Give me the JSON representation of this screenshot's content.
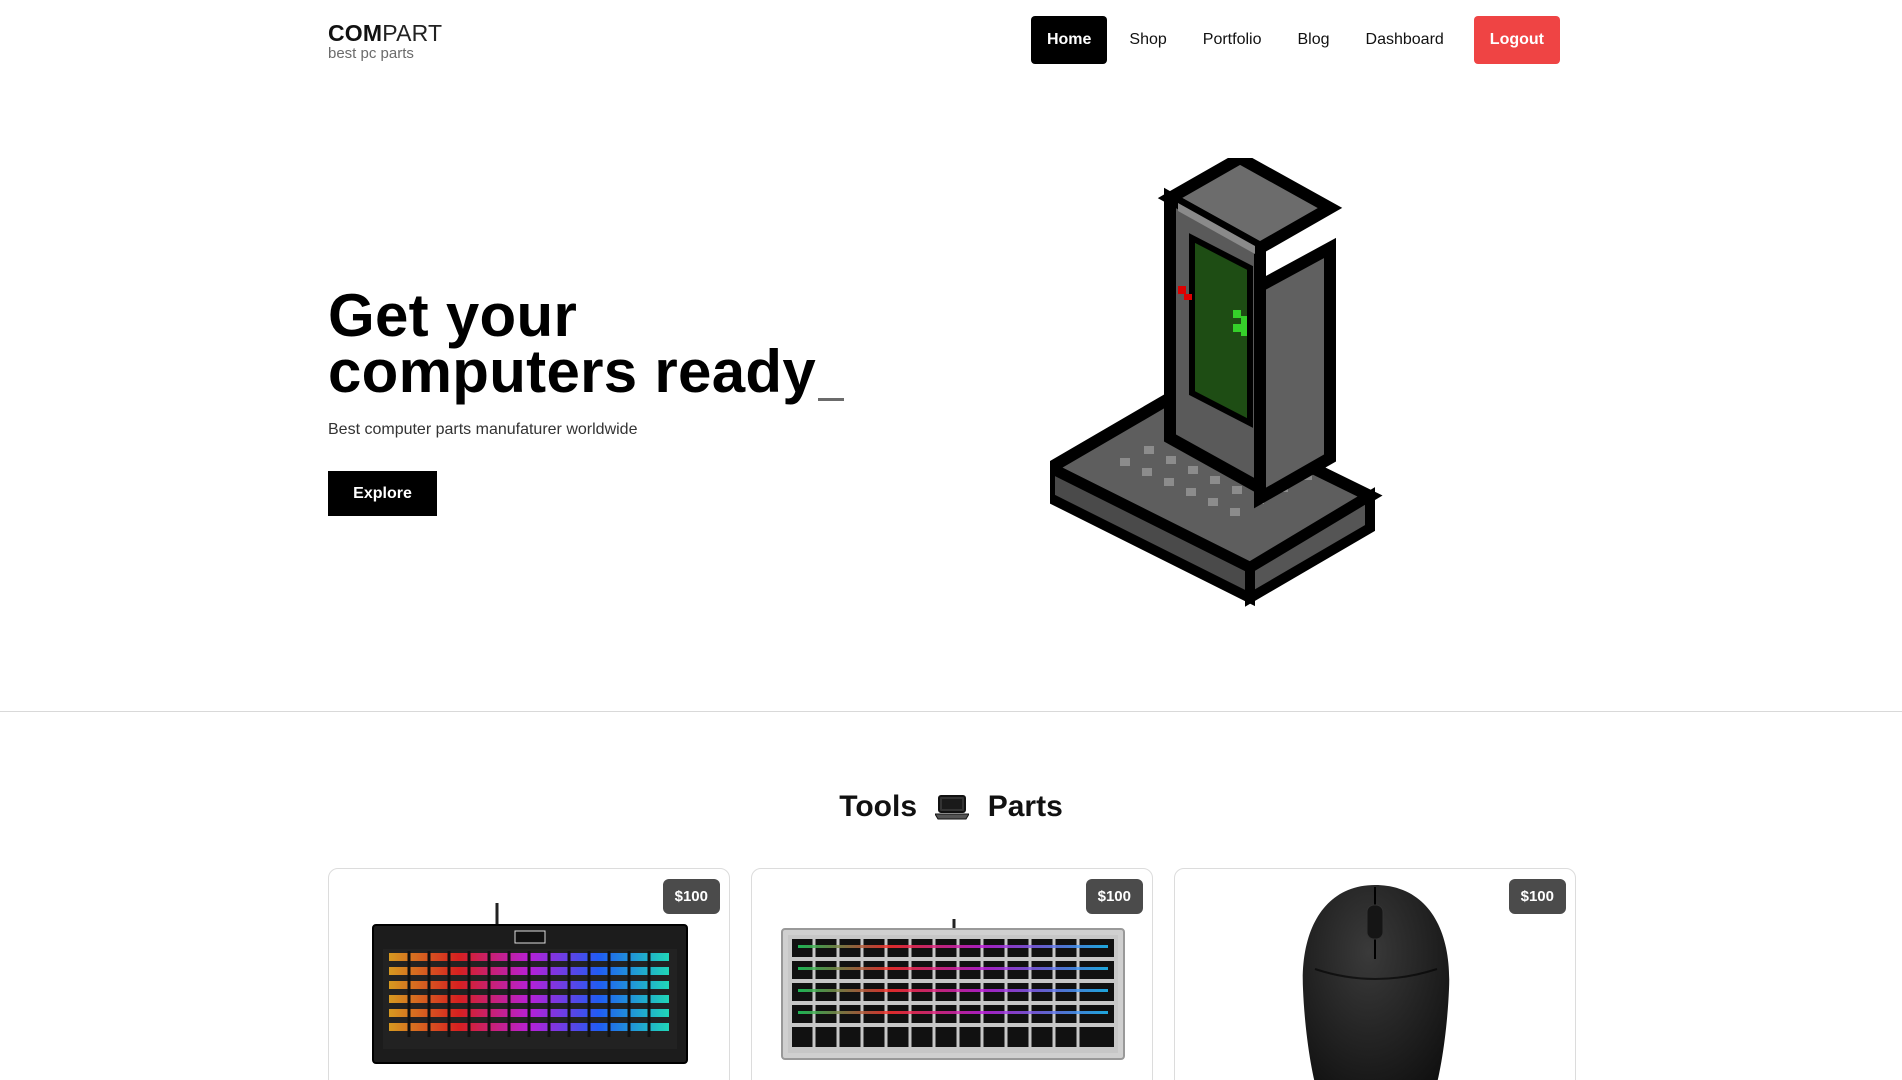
{
  "brand": {
    "strong": "COM",
    "light": "PART",
    "tagline": "best pc parts"
  },
  "nav": {
    "items": [
      {
        "label": "Home",
        "active": true
      },
      {
        "label": "Shop"
      },
      {
        "label": "Portfolio"
      },
      {
        "label": "Blog"
      },
      {
        "label": "Dashboard"
      }
    ],
    "logout_label": "Logout"
  },
  "hero": {
    "title_line1": "Get your",
    "title_line2": "computers ready",
    "subtitle": "Best computer parts manufaturer worldwide",
    "cta_label": "Explore",
    "illustration": "pixel-computer"
  },
  "parts": {
    "title_left": "Tools",
    "title_icon": "laptop-icon",
    "title_right": "Parts",
    "products": [
      {
        "image": "keyboard-rgb-black",
        "price": "$100"
      },
      {
        "image": "keyboard-rgb-silver",
        "price": "$100"
      },
      {
        "image": "mouse-black",
        "price": "$100"
      }
    ]
  },
  "colors": {
    "accent": "#000000",
    "logout": "#ef4444",
    "badge": "#4b4b4b",
    "screen": "#1e4d14"
  }
}
